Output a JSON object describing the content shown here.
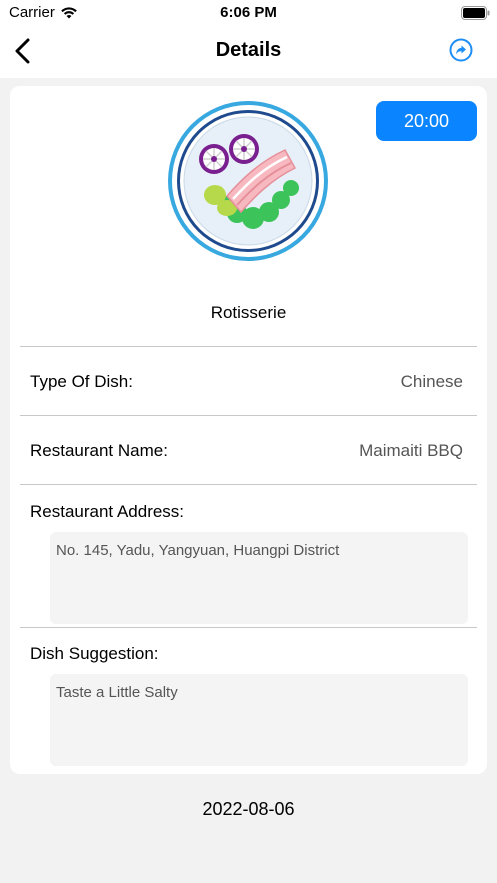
{
  "status_bar": {
    "carrier": "Carrier",
    "time": "6:06 PM",
    "wifi_icon": "wifi-icon",
    "battery_icon": "battery-icon"
  },
  "nav": {
    "title": "Details",
    "back_icon": "chevron-left-icon",
    "share_icon": "share-icon",
    "accent_color": "#1e8ef5"
  },
  "detail": {
    "time_badge": "20:00",
    "dish_name": "Rotisserie",
    "type_label": "Type Of Dish:",
    "type_value": "Chinese",
    "restaurant_label": "Restaurant Name:",
    "restaurant_value": "Maimaiti BBQ",
    "address_label": "Restaurant Address:",
    "address_value": "No. 145, Yadu, Yangyuan, Huangpi District",
    "suggestion_label": "Dish Suggestion:",
    "suggestion_value": "Taste a Little Salty",
    "date": "2022-08-06"
  },
  "colors": {
    "badge": "#0a84ff",
    "background": "#f2f2f2",
    "card": "#ffffff"
  }
}
